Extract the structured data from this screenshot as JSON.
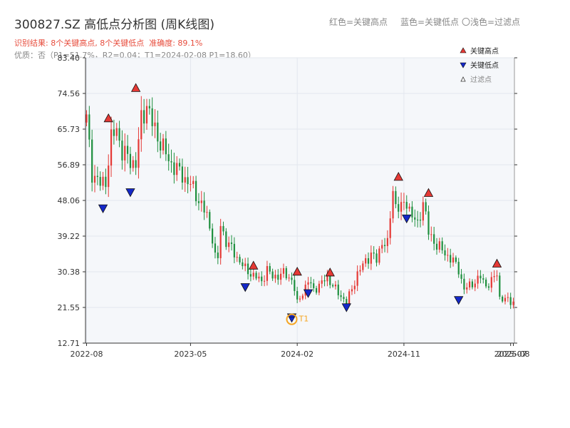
{
  "header": {
    "title": "300827.SZ 高低点分析图 (周K线图)",
    "legend_red": "红色=关键高点",
    "legend_blue": "蓝色=关键低点",
    "legend_light": "〇浅色=过滤点",
    "result_label": "识别结果: 8个关键高点, 8个关键低点",
    "accuracy_label": "准确度: 89.1%",
    "quality_line": "优质：否（P1=51.7%，R2=0.04；T1=2024-02-08 P1=18.60）"
  },
  "colors": {
    "up": "#e53935",
    "down": "#1e8f3e",
    "high_marker": "#e53935",
    "low_marker": "#1428c8",
    "highlight": "#f5a623",
    "result_text": "#e74c3c",
    "plot_bg": "#f5f7fa"
  },
  "chart_data": {
    "type": "candlestick",
    "period": "weekly",
    "ylim": [
      12.71,
      83.4
    ],
    "y_ticks": [
      "12.71",
      "21.55",
      "30.38",
      "39.22",
      "48.06",
      "56.89",
      "65.73",
      "74.56",
      "83.40"
    ],
    "x_ticks": [
      "2022-08",
      "2023-05",
      "2024-02",
      "2024-11",
      "2025-07",
      "2025-08"
    ],
    "grid": true,
    "legend_position": "top-right",
    "legend": [
      {
        "label": "关键高点",
        "kind": "high"
      },
      {
        "label": "关键低点",
        "kind": "low"
      },
      {
        "label": "过滤点",
        "kind": "filtered"
      }
    ],
    "anchors": [
      {
        "w": 0,
        "v": 68
      },
      {
        "w": 2,
        "v": 55
      },
      {
        "w": 5,
        "v": 52
      },
      {
        "w": 7,
        "v": 53
      },
      {
        "w": 9,
        "v": 63
      },
      {
        "w": 11,
        "v": 66
      },
      {
        "w": 13,
        "v": 60
      },
      {
        "w": 16,
        "v": 58
      },
      {
        "w": 18,
        "v": 57
      },
      {
        "w": 20,
        "v": 68
      },
      {
        "w": 22,
        "v": 72
      },
      {
        "w": 24,
        "v": 67
      },
      {
        "w": 26,
        "v": 64
      },
      {
        "w": 30,
        "v": 58
      },
      {
        "w": 34,
        "v": 55
      },
      {
        "w": 38,
        "v": 52
      },
      {
        "w": 42,
        "v": 47
      },
      {
        "w": 44,
        "v": 44
      },
      {
        "w": 46,
        "v": 39
      },
      {
        "w": 47,
        "v": 34
      },
      {
        "w": 48,
        "v": 33.5
      },
      {
        "w": 49,
        "v": 42
      },
      {
        "w": 51,
        "v": 38
      },
      {
        "w": 54,
        "v": 35
      },
      {
        "w": 58,
        "v": 31
      },
      {
        "w": 62,
        "v": 29
      },
      {
        "w": 64,
        "v": 28
      },
      {
        "w": 66,
        "v": 31
      },
      {
        "w": 68,
        "v": 29
      },
      {
        "w": 72,
        "v": 30
      },
      {
        "w": 75,
        "v": 28.5
      },
      {
        "w": 76,
        "v": 26
      },
      {
        "w": 77,
        "v": 22.5
      },
      {
        "w": 78,
        "v": 24
      },
      {
        "w": 81,
        "v": 28
      },
      {
        "w": 83,
        "v": 26
      },
      {
        "w": 85,
        "v": 27
      },
      {
        "w": 88,
        "v": 29
      },
      {
        "w": 90,
        "v": 27
      },
      {
        "w": 92,
        "v": 25
      },
      {
        "w": 95,
        "v": 23
      },
      {
        "w": 97,
        "v": 26
      },
      {
        "w": 99,
        "v": 30
      },
      {
        "w": 102,
        "v": 33
      },
      {
        "w": 104,
        "v": 35
      },
      {
        "w": 106,
        "v": 33
      },
      {
        "w": 108,
        "v": 38
      },
      {
        "w": 110,
        "v": 37
      },
      {
        "w": 111,
        "v": 44
      },
      {
        "w": 112,
        "v": 51
      },
      {
        "w": 113,
        "v": 47
      },
      {
        "w": 115,
        "v": 46
      },
      {
        "w": 117,
        "v": 48
      },
      {
        "w": 119,
        "v": 44
      },
      {
        "w": 121,
        "v": 42
      },
      {
        "w": 123,
        "v": 48
      },
      {
        "w": 125,
        "v": 40
      },
      {
        "w": 128,
        "v": 37
      },
      {
        "w": 131,
        "v": 35
      },
      {
        "w": 134,
        "v": 33
      },
      {
        "w": 136,
        "v": 31
      },
      {
        "w": 138,
        "v": 26
      },
      {
        "w": 140,
        "v": 27
      },
      {
        "w": 142,
        "v": 28
      },
      {
        "w": 144,
        "v": 29
      },
      {
        "w": 146,
        "v": 27
      },
      {
        "w": 148,
        "v": 28
      },
      {
        "w": 150,
        "v": 30
      },
      {
        "w": 151,
        "v": 24
      },
      {
        "w": 153,
        "v": 23.5
      },
      {
        "w": 155,
        "v": 23
      }
    ],
    "key_highs": [
      {
        "w": 8,
        "price": 67.0
      },
      {
        "w": 18,
        "price": 74.5
      },
      {
        "w": 61,
        "price": 30.5
      },
      {
        "w": 77,
        "price": 29.0
      },
      {
        "w": 89,
        "price": 28.8
      },
      {
        "w": 114,
        "price": 52.5
      },
      {
        "w": 125,
        "price": 48.5
      },
      {
        "w": 150,
        "price": 31.0
      }
    ],
    "key_lows": [
      {
        "w": 6,
        "price": 47.5
      },
      {
        "w": 16,
        "price": 51.5
      },
      {
        "w": 58,
        "price": 28.0
      },
      {
        "w": 75,
        "price": 20.5
      },
      {
        "w": 81,
        "price": 26.5
      },
      {
        "w": 95,
        "price": 23.0
      },
      {
        "w": 117,
        "price": 45.0
      },
      {
        "w": 136,
        "price": 24.8
      }
    ],
    "highlight": {
      "w": 75,
      "price": 18.6,
      "label": "T1"
    }
  }
}
